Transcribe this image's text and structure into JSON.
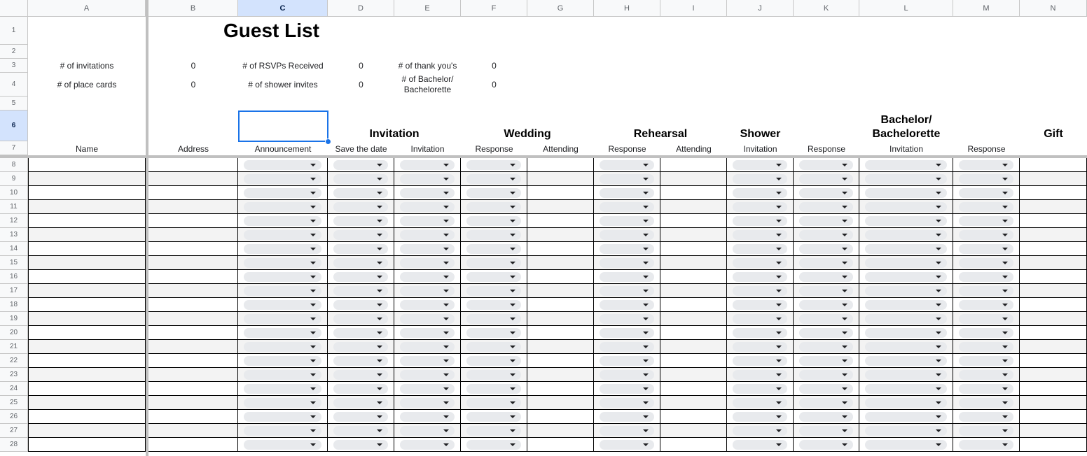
{
  "app": {
    "title": "Guest List"
  },
  "columns": [
    "A",
    "B",
    "C",
    "D",
    "E",
    "F",
    "G",
    "H",
    "I",
    "J",
    "K",
    "L",
    "M",
    "N"
  ],
  "selected_column": "C",
  "selected_row": 6,
  "rows": [
    1,
    2,
    3,
    4,
    5,
    6,
    7,
    8,
    9,
    10,
    11,
    12,
    13,
    14,
    15,
    16,
    17,
    18,
    19,
    20,
    21,
    22,
    23,
    24,
    25,
    26,
    27,
    28
  ],
  "summary": {
    "invitations_label": "# of invitations",
    "invitations_value": "0",
    "place_cards_label": "# of place cards",
    "place_cards_value": "0",
    "rsvps_label": "# of RSVPs Received",
    "rsvps_value": "0",
    "shower_invites_label": "# of shower invites",
    "shower_invites_value": "0",
    "thank_yous_label": "# of thank you's",
    "thank_yous_value": "0",
    "bachelor_label": "# of Bachelor/ Bachelorette",
    "bachelor_value": "0"
  },
  "groups": {
    "invitation": "Invitation",
    "wedding": "Wedding",
    "rehearsal": "Rehearsal",
    "shower": "Shower",
    "bachelor": "Bachelor/ Bachelorette",
    "gift": "Gift"
  },
  "subheaders": {
    "name": "Name",
    "address": "Address",
    "announcement": "Announcement",
    "save_the_date": "Save the date",
    "invitation_e": "Invitation",
    "response_f": "Response",
    "attending_g": "Attending",
    "response_h": "Response",
    "attending_i": "Attending",
    "invitation_j": "Invitation",
    "response_k": "Response",
    "invitation_l": "Invitation",
    "response_m": "Response"
  },
  "dropdown_columns": [
    "C",
    "D",
    "E",
    "F",
    "H",
    "J",
    "K",
    "L",
    "M"
  ]
}
